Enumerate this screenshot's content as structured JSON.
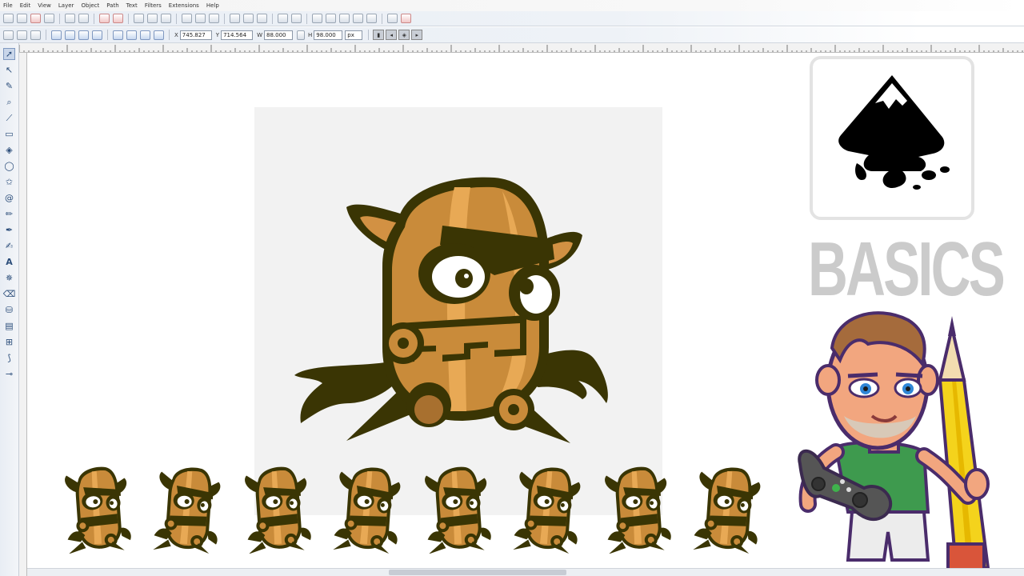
{
  "menu": [
    "File",
    "Edit",
    "View",
    "Layer",
    "Object",
    "Path",
    "Text",
    "Filters",
    "Extensions",
    "Help"
  ],
  "controls": {
    "x_label": "X",
    "x_value": "745.827",
    "y_label": "Y",
    "y_value": "714.564",
    "w_label": "W",
    "w_value": "88.000",
    "h_label": "H",
    "h_value": "98.000",
    "unit": "px"
  },
  "overlay": {
    "title": "BASICS"
  },
  "colors": {
    "robot_dark": "#3a3504",
    "robot_mid": "#c98b3a",
    "robot_light": "#e8a955",
    "page_bg": "#f2f2f2",
    "basics_text": "#cbcbcb"
  },
  "tools": [
    "select-icon",
    "node-icon",
    "tweak-icon",
    "zoom-icon",
    "measure-icon",
    "rect-icon",
    "3dbox-icon",
    "ellipse-icon",
    "star-icon",
    "spiral-icon",
    "pencil-icon",
    "pen-icon",
    "calligraphy-icon",
    "text-icon",
    "spray-icon",
    "eraser-icon",
    "bucket-icon",
    "gradient-icon",
    "mesh-icon",
    "dropper-icon",
    "connector-icon"
  ],
  "sprite_count": 8
}
